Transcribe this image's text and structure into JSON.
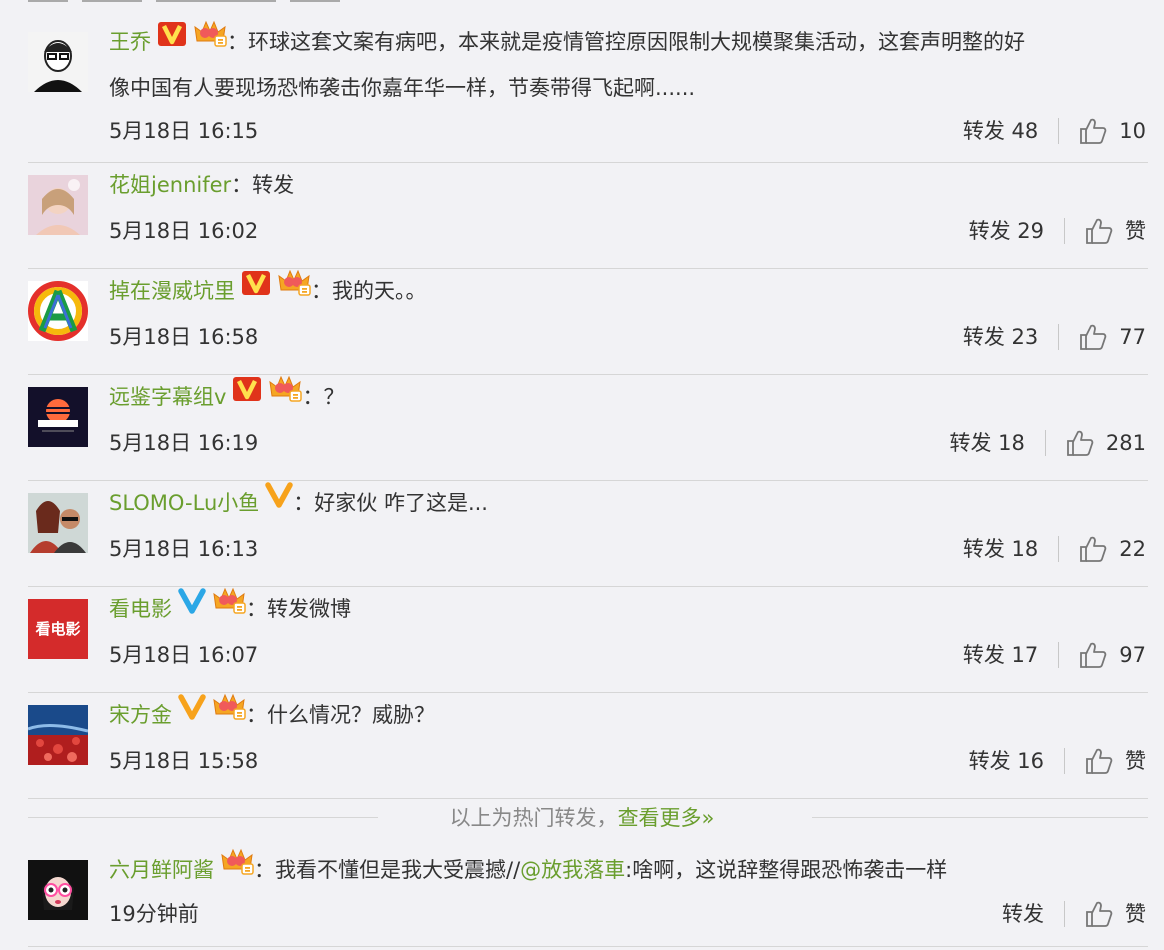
{
  "colors": {
    "link_green": "#6a9e2e",
    "vip_red": "#e0331a",
    "vip_orange": "#f7a21b",
    "vip_blue": "#2ba7e6"
  },
  "comments": [
    {
      "user": "王乔",
      "badges": [
        "vip-red-v",
        "crown-icon"
      ],
      "text": "环球这套文案有病吧，本来就是疫情管控原因限制大规模聚集活动，这套声明整的好",
      "text2": "像中国有人要现场恐怖袭击你嘉年华一样，节奏带得飞起啊......",
      "time": "5月18日 16:15",
      "repost": "转发 48",
      "like": "10"
    },
    {
      "user": "花姐jennifer",
      "badges": [],
      "text": "转发",
      "time": "5月18日 16:02",
      "repost": "转发 29",
      "like": "赞"
    },
    {
      "user": "掉在漫威坑里",
      "badges": [
        "vip-red-v",
        "crown-icon"
      ],
      "text": "我的天。。",
      "time": "5月18日 16:58",
      "repost": "转发 23",
      "like": "77"
    },
    {
      "user": "远鉴字幕组v",
      "badges": [
        "vip-red-v",
        "crown-icon"
      ],
      "text": "？",
      "time": "5月18日 16:19",
      "repost": "转发 18",
      "like": "281"
    },
    {
      "user": "SLOMO-Lu小鱼",
      "badges": [
        "vip-orange-v"
      ],
      "text": "好家伙 咋了这是...",
      "time": "5月18日 16:13",
      "repost": "转发 18",
      "like": "22"
    },
    {
      "user": "看电影",
      "badges": [
        "vip-blue-v",
        "crown-icon"
      ],
      "text": "转发微博",
      "time": "5月18日 16:07",
      "repost": "转发 17",
      "like": "97",
      "avatar_text": "看电影"
    },
    {
      "user": "宋方金",
      "badges": [
        "vip-orange-v",
        "crown-icon"
      ],
      "text": "什么情况？威胁？",
      "time": "5月18日 15:58",
      "repost": "转发 16",
      "like": "赞"
    }
  ],
  "hot_notice": {
    "text": "以上为热门转发，",
    "more": "查看更多»"
  },
  "latest": {
    "user": "六月鲜阿酱",
    "badges": [
      "crown-icon"
    ],
    "text_before": "我看不懂但是我大受震撼//",
    "mention": "@放我落車",
    "text_after": ":啥啊，这说辞整得跟恐怖袭击一样",
    "time": "19分钟前",
    "repost": "转发",
    "like": "赞"
  }
}
